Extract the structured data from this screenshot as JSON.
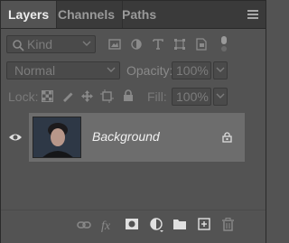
{
  "tabs": [
    {
      "label": "Layers",
      "active": true
    },
    {
      "label": "Channels",
      "active": false
    },
    {
      "label": "Paths",
      "active": false
    }
  ],
  "filter": {
    "selected": "Kind"
  },
  "blend": {
    "mode": "Normal",
    "opacity_label": "Opacity:",
    "opacity_value": "100%"
  },
  "lock": {
    "label": "Lock:",
    "fill_label": "Fill:",
    "fill_value": "100%"
  },
  "layers": [
    {
      "name": "Background",
      "visible": true,
      "locked": true
    }
  ],
  "colors": {
    "panel": "#535353",
    "selected_row": "#6d6d6d",
    "tabbar": "#3a3a3a",
    "text": "#ededed"
  },
  "icons": {
    "filter_bar": [
      "search-icon",
      "image-filter-icon",
      "adjustment-filter-icon",
      "type-filter-icon",
      "shape-filter-icon",
      "smart-object-filter-icon",
      "filter-toggle-icon"
    ],
    "lock_bar": [
      "lock-transparent-icon",
      "lock-pixels-icon",
      "lock-position-icon",
      "lock-artboard-icon",
      "lock-all-icon"
    ],
    "bottom_bar": [
      "link-icon",
      "fx-icon",
      "mask-icon",
      "adjustment-icon",
      "folder-icon",
      "new-layer-icon",
      "trash-icon"
    ]
  }
}
